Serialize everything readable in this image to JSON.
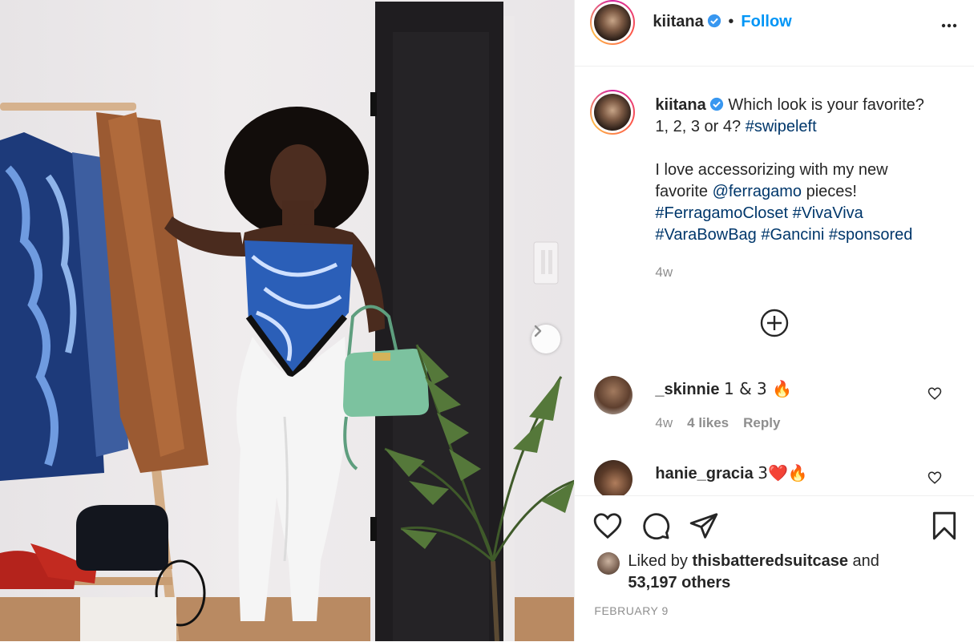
{
  "post": {
    "username": "kiitana",
    "follow_label": "Follow",
    "separator": "•",
    "caption": {
      "line1": "Which look is your favorite?",
      "line2a": "1, 2, 3 or 4? ",
      "line2_tag": "#swipeleft",
      "line3a": "I love accessorizing with my new",
      "line4a": "favorite ",
      "line4_mention": "@ferragamo",
      "line4b": " pieces!",
      "line5": "#FerragamoCloset #VivaViva",
      "line6": "#VaraBowBag #Gancini #sponsored"
    },
    "age": "4w"
  },
  "comments": [
    {
      "username": "_skinnie",
      "text": "1 & 3 🔥",
      "age": "4w",
      "likes": "4 likes",
      "reply": "Reply"
    },
    {
      "username": "hanie_gracia",
      "text": "3❤️🔥"
    }
  ],
  "likes": {
    "prefix": "Liked by ",
    "user": "thisbatteredsuitcase",
    "and": " and",
    "others": "53,197 others"
  },
  "date": "FEBRUARY 9",
  "icons": {
    "verified": "verified-badge-icon",
    "more": "more-options-icon",
    "load_more": "plus-circle-icon",
    "like": "heart-icon",
    "comment": "comment-bubble-icon",
    "share": "paper-plane-icon",
    "save": "bookmark-icon",
    "next": "chevron-right-icon"
  },
  "colors": {
    "accent": "#0095f6",
    "hashtag": "#00376b",
    "muted": "#8e8e8e",
    "text": "#262626"
  }
}
